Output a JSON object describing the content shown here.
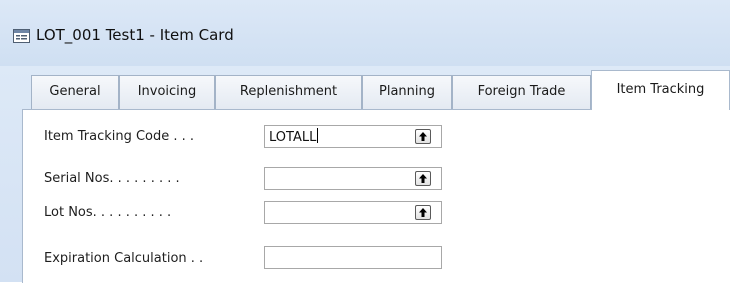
{
  "window": {
    "title": "LOT_001 Test1 - Item Card",
    "icon": "item-card-form-icon"
  },
  "tabs": [
    {
      "label": "General",
      "active": false
    },
    {
      "label": "Invoicing",
      "active": false
    },
    {
      "label": "Replenishment",
      "active": false
    },
    {
      "label": "Planning",
      "active": false
    },
    {
      "label": "Foreign Trade",
      "active": false
    },
    {
      "label": "Item Tracking",
      "active": true
    }
  ],
  "fields": {
    "item_tracking_code": {
      "label": "Item Tracking Code . . .",
      "value": "LOTALL",
      "lookup_icon": "lookup-arrow-icon"
    },
    "serial_nos": {
      "label": "Serial Nos. . . . . . . . .",
      "value": "",
      "lookup_icon": "lookup-arrow-icon"
    },
    "lot_nos": {
      "label": "Lot Nos. . . . . . . . . .",
      "value": "",
      "lookup_icon": "lookup-arrow-icon"
    },
    "expiration_calculation": {
      "label": "Expiration Calculation . .",
      "value": ""
    }
  },
  "colors": {
    "window_frame": "#d3e1f3",
    "tab_border": "#a3b3c7",
    "field_border": "#a8a8a8"
  }
}
